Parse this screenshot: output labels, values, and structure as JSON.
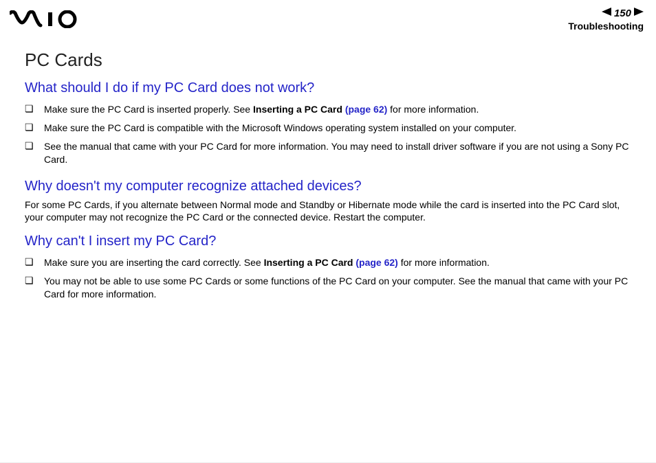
{
  "header": {
    "page_number": "150",
    "section_title": "Troubleshooting"
  },
  "content": {
    "h1": "PC Cards",
    "q1": {
      "title": "What should I do if my PC Card does not work?",
      "items": [
        {
          "pre": "Make sure the PC Card is inserted properly. See ",
          "bold": "Inserting a PC Card ",
          "link": "(page 62)",
          "post": " for more information."
        },
        {
          "text": "Make sure the PC Card is compatible with the Microsoft Windows operating system installed on your computer."
        },
        {
          "text": "See the manual that came with your PC Card for more information. You may need to install driver software if you are not using a Sony PC Card."
        }
      ]
    },
    "q2": {
      "title": "Why doesn't my computer recognize attached devices?",
      "para": "For some PC Cards, if you alternate between Normal mode and Standby or Hibernate mode while the card is inserted into the PC Card slot, your computer may not recognize the PC Card or the connected device. Restart the computer."
    },
    "q3": {
      "title": "Why can't I insert my PC Card?",
      "items": [
        {
          "pre": "Make sure you are inserting the card correctly. See ",
          "bold": "Inserting a PC Card ",
          "link": "(page 62)",
          "post": " for more information."
        },
        {
          "text": "You may not be able to use some PC Cards or some functions of the PC Card on your computer. See the manual that came with your PC Card for more information."
        }
      ]
    }
  }
}
